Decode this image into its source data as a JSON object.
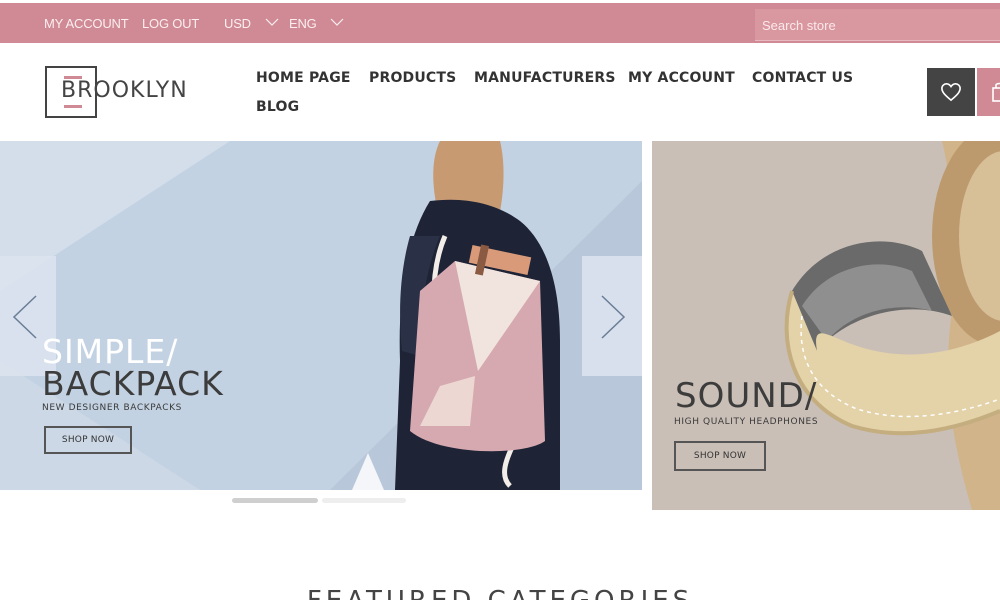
{
  "topbar": {
    "my_account": "MY ACCOUNT",
    "log_out": "LOG OUT",
    "currency": "USD",
    "language": "ENG",
    "search_placeholder": "Search store"
  },
  "logo": {
    "text": "BROOKLYN"
  },
  "nav": {
    "items": [
      "HOME PAGE",
      "PRODUCTS",
      "MANUFACTURERS",
      "MY ACCOUNT",
      "CONTACT US",
      "BLOG"
    ]
  },
  "header_icons": {
    "wishlist_icon": "heart-icon",
    "cart_icon": "shopping-bag-icon"
  },
  "slider": {
    "title_line1": "SIMPLE/",
    "title_line2": "BACKPACK",
    "subtitle": "NEW DESIGNER BACKPACKS",
    "button": "SHOP NOW",
    "prev_icon": "chevron-left-icon",
    "next_icon": "chevron-right-icon",
    "slide_count": 2,
    "active_slide": 1
  },
  "banner": {
    "title": "SOUND/",
    "subtitle": "HIGH QUALITY HEADPHONES",
    "button": "SHOP NOW"
  },
  "featured": {
    "title": "FEATURED CATEGORIES"
  },
  "colors": {
    "accent": "#d08a95",
    "dark": "#444444",
    "slider_bg": "#c3d2e2",
    "banner_bg": "#c9bfb7"
  }
}
